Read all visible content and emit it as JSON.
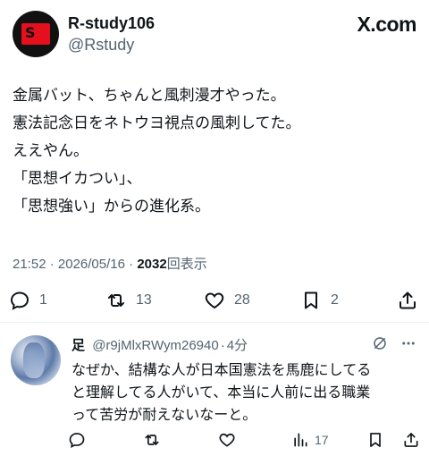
{
  "header": {
    "display_name": "R-study106",
    "handle": "@Rstudy",
    "brand": "X.com",
    "avatar_text": "S"
  },
  "tweet": {
    "lines": [
      "金属バット、ちゃんと風刺漫才やった。",
      "憲法記念日をネトウヨ視点の風刺してた。",
      "ええやん。",
      "「思想イカつい」、",
      "「思想強い」からの進化系。"
    ],
    "time": "21:52",
    "separator": "·",
    "date": "2026/05/16",
    "views_count": "2032",
    "views_label": "回表示"
  },
  "actions": {
    "replies": "1",
    "retweets": "13",
    "likes": "28",
    "bookmarks": "2"
  },
  "reply": {
    "name": "足",
    "handle": "@r9jMlxRWym26940",
    "separator": "·",
    "time": "4分",
    "lines": [
      "なぜか、結構な人が日本国憲法を馬鹿にしてる",
      "と理解してる人がいて、本当に人前に出る職業",
      "って苦労が耐えないなーと。"
    ],
    "views": "17"
  },
  "colors": {
    "text": "#0f1419",
    "secondary": "#536471",
    "divider": "#eff3f4",
    "brand_red": "#e5101d"
  }
}
